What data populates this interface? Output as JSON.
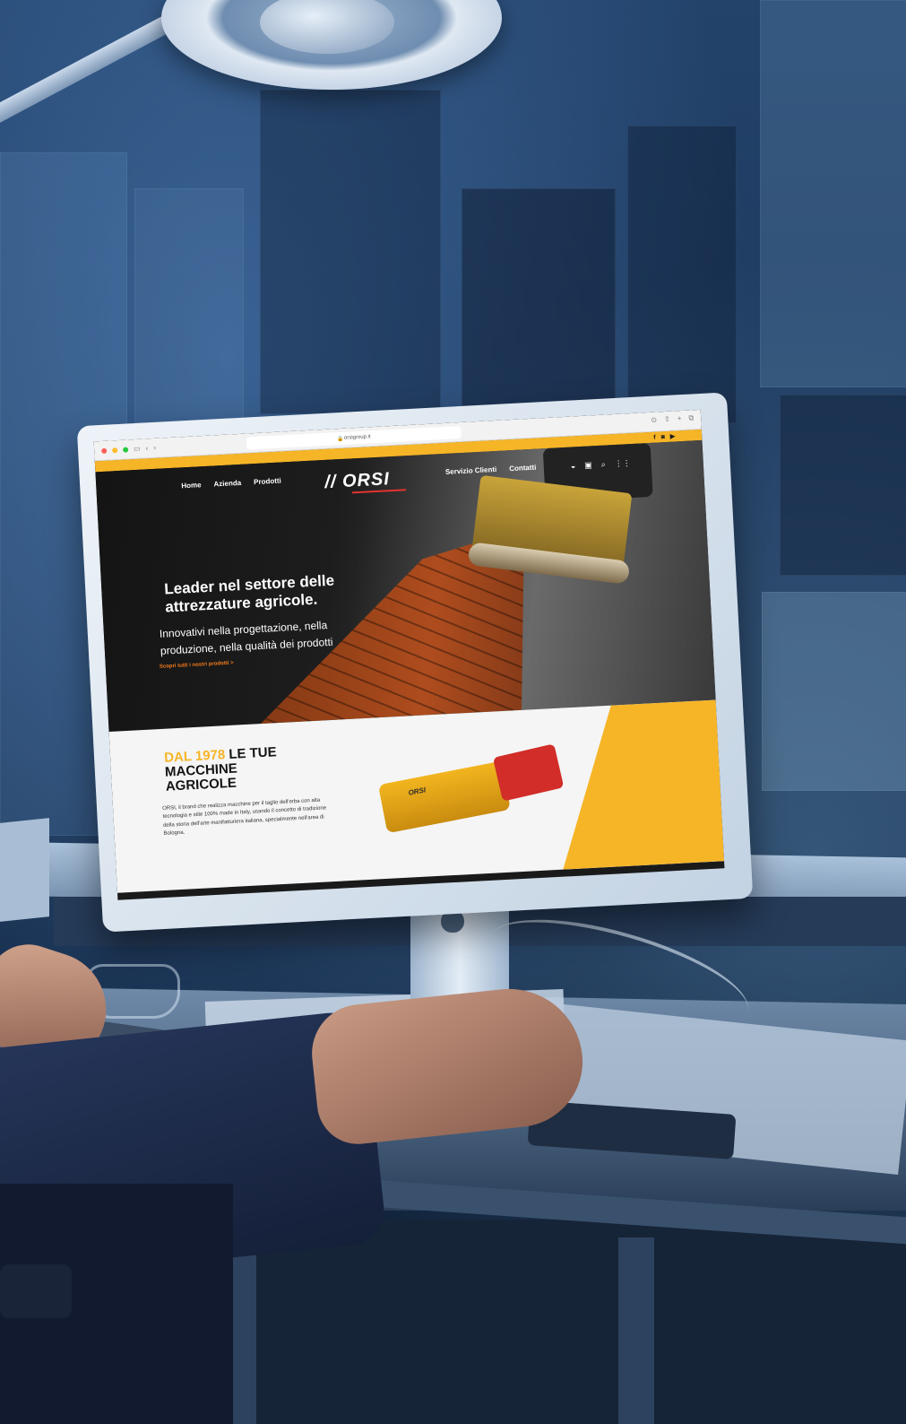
{
  "browser": {
    "url": "orsigroup.it"
  },
  "site": {
    "social": [
      "f",
      "◙",
      "▶"
    ],
    "nav_left": [
      "Home",
      "Azienda",
      "Prodotti"
    ],
    "logo": "ORSI",
    "nav_right": [
      "Servizio Clienti",
      "Contatti"
    ],
    "hero": {
      "title_line1": "Leader nel settore delle",
      "title_line2": "attrezzature agricole.",
      "sub_line1": "Innovativi nella progettazione, nella",
      "sub_line2": "produzione, nella qualità dei prodotti",
      "link": "Scopri tutti i nostri prodotti >"
    },
    "section": {
      "title_highlight": "DAL 1978",
      "title_rest_1": " LE TUE",
      "title_rest_2": "MACCHINE",
      "title_rest_3": "AGRICOLE",
      "text": "ORSI, il brand che realizza macchine per il taglio dell'erba con alta tecnologia e stile 100% made in Italy, usando il concetto di tradizione della storia dell'arte manifatturiera italiana, specialmente nell'area di Bologna.",
      "product_logo": "ORSI"
    }
  },
  "colors": {
    "brand_yellow": "#f6b527",
    "accent_orange": "#f07a1e",
    "logo_red": "#e3342f"
  }
}
